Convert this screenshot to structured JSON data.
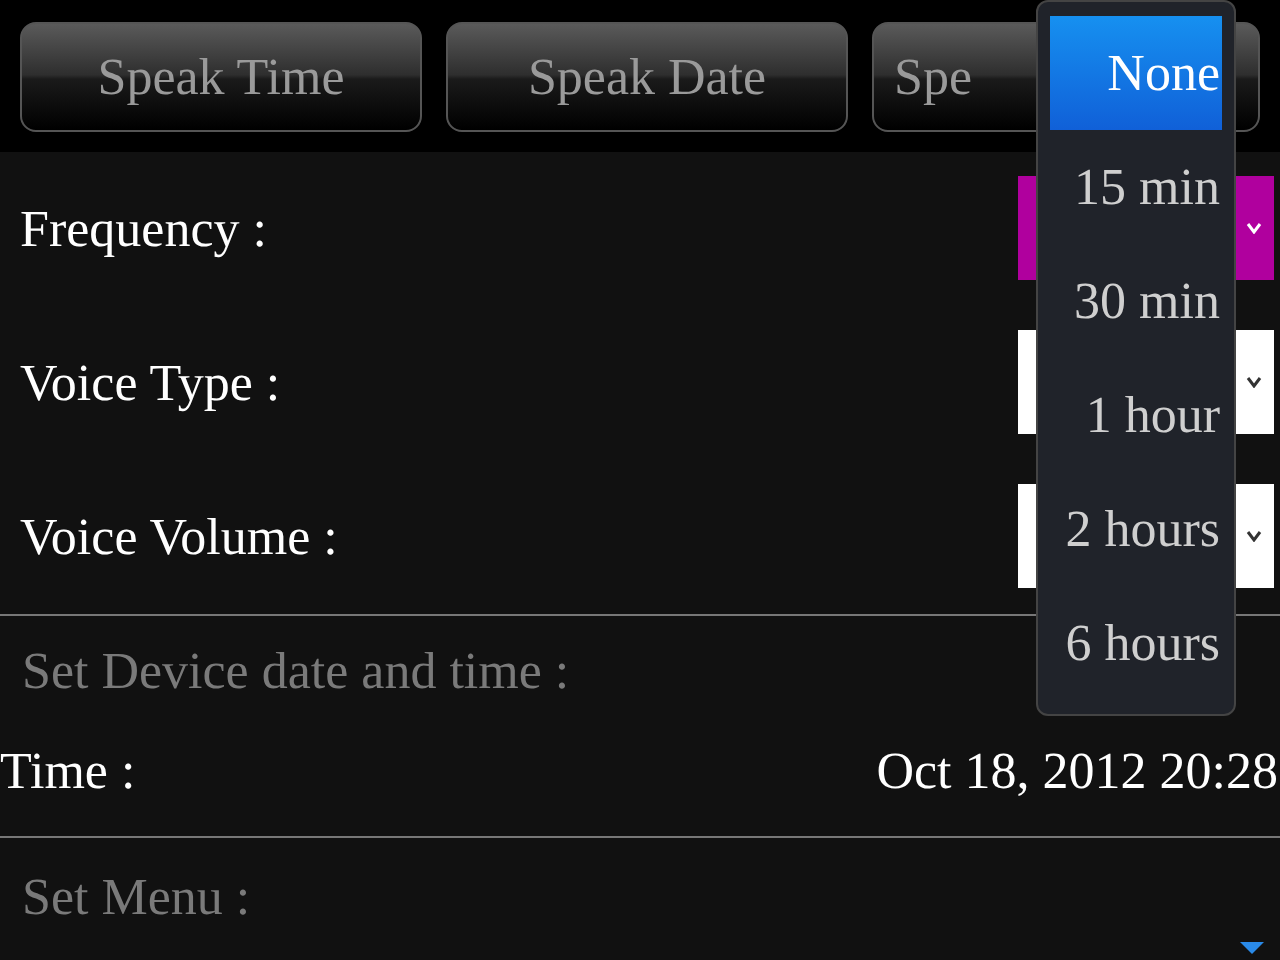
{
  "toolbar": {
    "buttons": [
      {
        "label": "Speak Time"
      },
      {
        "label": "Speak Date"
      },
      {
        "label": "Spe"
      }
    ]
  },
  "settings": [
    {
      "label": "Frequency :",
      "focused": true
    },
    {
      "label": "Voice Type :",
      "focused": false
    },
    {
      "label": "Voice Volume :",
      "focused": false
    }
  ],
  "device_section": {
    "heading": "Set Device date and time :",
    "time_label": "Time :",
    "time_value": "Oct 18, 2012 20:28"
  },
  "menu_section": {
    "heading": "Set Menu :"
  },
  "dropdown": {
    "options": [
      {
        "label": "None",
        "selected": true
      },
      {
        "label": "15 min",
        "selected": false
      },
      {
        "label": "30 min",
        "selected": false
      },
      {
        "label": "1 hour",
        "selected": false
      },
      {
        "label": "2 hours",
        "selected": false
      },
      {
        "label": "6 hours",
        "selected": false
      }
    ]
  }
}
